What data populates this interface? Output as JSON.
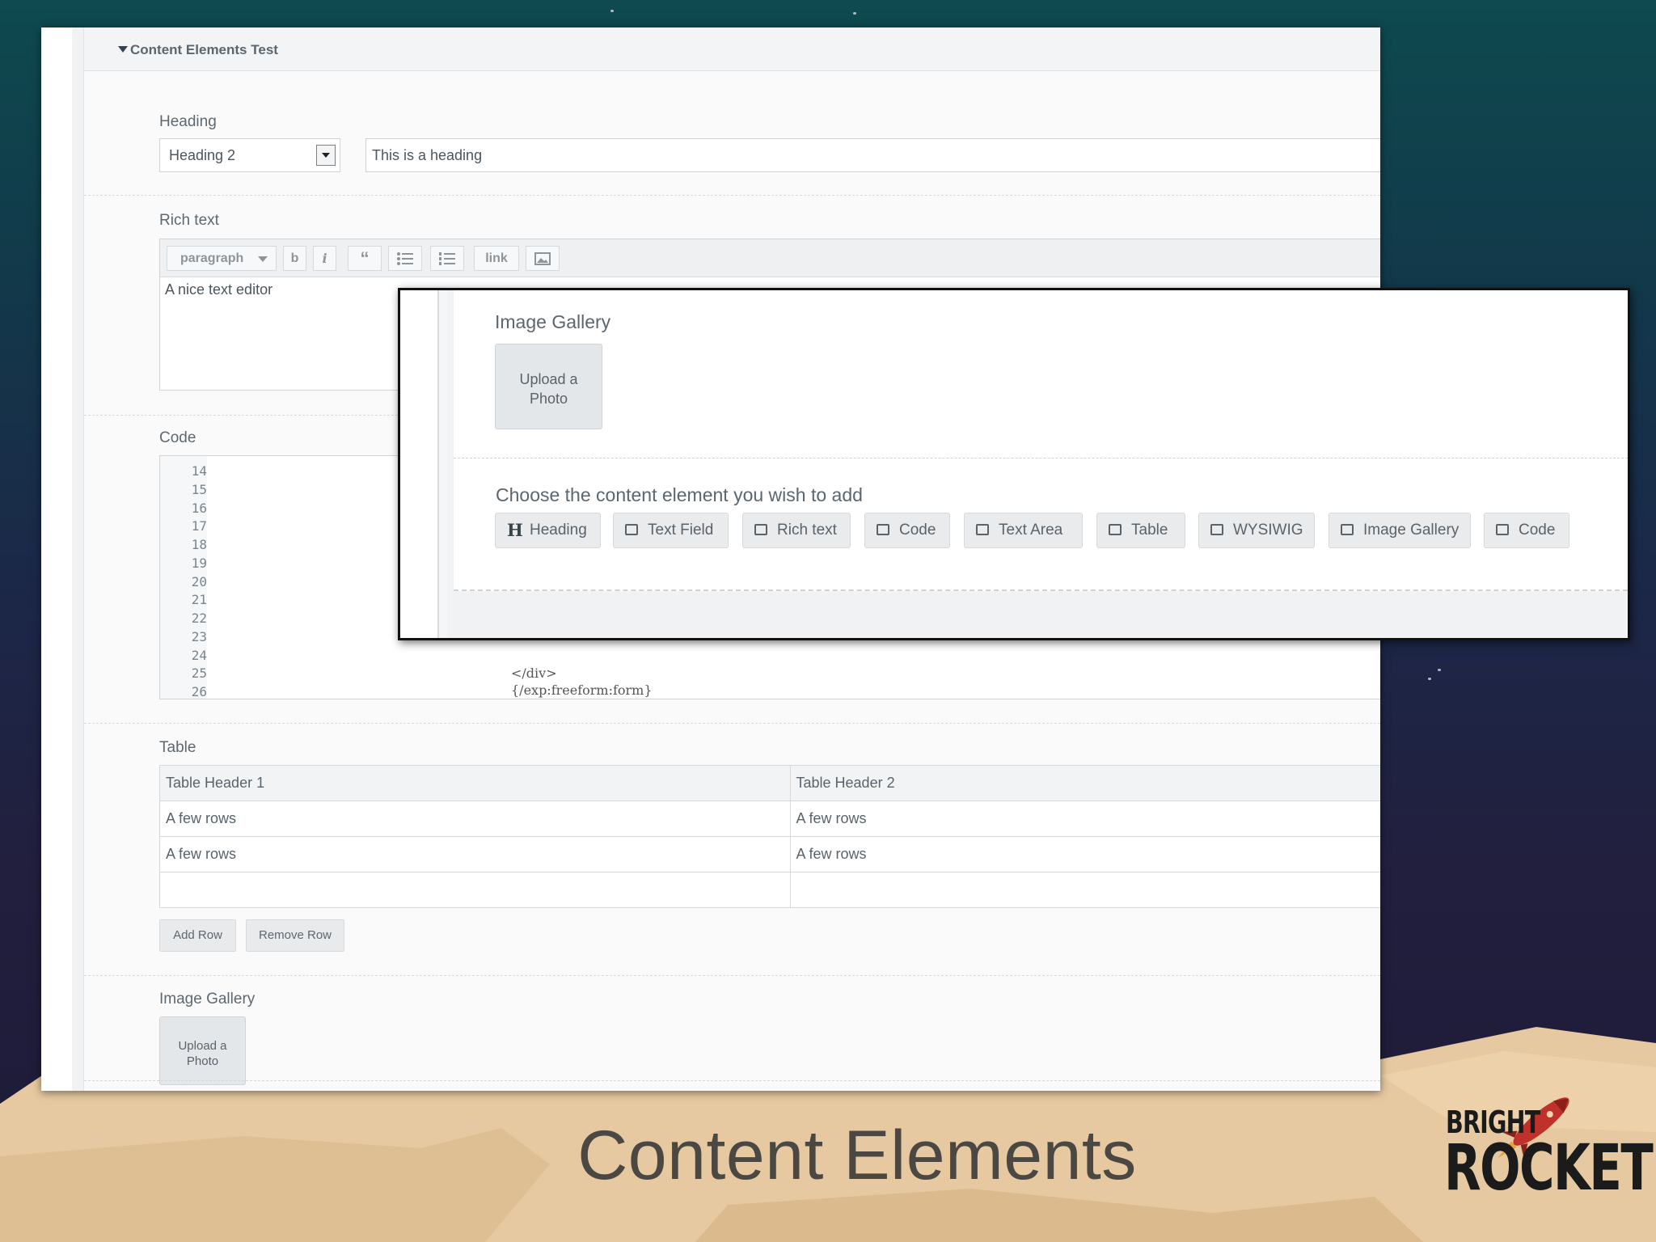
{
  "section": {
    "title": "Content Elements Test"
  },
  "heading_field": {
    "label": "Heading",
    "select_value": "Heading 2",
    "text_value": "This is a heading"
  },
  "rich_text": {
    "label": "Rich text",
    "toolbar": {
      "format": "paragraph",
      "bold": "b",
      "italic": "i",
      "quote": "“",
      "link": "link"
    },
    "content": "A nice text editor"
  },
  "code": {
    "label": "Code",
    "line_numbers": [
      "14",
      "15",
      "16",
      "17",
      "18",
      "19",
      "20",
      "21",
      "22",
      "23",
      "24",
      "25",
      "26"
    ],
    "visible_lines": [
      "</div>",
      "{/exp:freeform:form}"
    ]
  },
  "table": {
    "label": "Table",
    "headers": [
      "Table Header 1",
      "Table Header 2"
    ],
    "rows": [
      [
        "A few rows",
        "A few rows"
      ],
      [
        "A few rows",
        "A few rows"
      ],
      [
        "",
        ""
      ]
    ],
    "add_row": "Add Row",
    "remove_row": "Remove Row"
  },
  "gallery": {
    "label": "Image Gallery",
    "upload_line1": "Upload a",
    "upload_line2": "Photo"
  },
  "zoom": {
    "gallery_label": "Image Gallery",
    "upload_line1": "Upload a",
    "upload_line2": "Photo",
    "choose_label": "Choose the content element you wish to add",
    "buttons": [
      {
        "label": "Heading",
        "icon": "heading-icon"
      },
      {
        "label": "Text Field",
        "icon": "text-field-icon"
      },
      {
        "label": "Rich text",
        "icon": "rich-text-icon"
      },
      {
        "label": "Code",
        "icon": "code-icon"
      },
      {
        "label": "Text Area",
        "icon": "text-area-icon"
      },
      {
        "label": "Table",
        "icon": "table-icon"
      },
      {
        "label": "WYSIWIG",
        "icon": "wysiwyg-icon"
      },
      {
        "label": "Image Gallery",
        "icon": "image-gallery-icon"
      },
      {
        "label": "Code",
        "icon": "code-icon"
      }
    ]
  },
  "slide": {
    "title": "Content Elements",
    "logo_top": "BRIGHT",
    "logo_bottom": "ROCKET"
  },
  "colors": {
    "rocket_red": "#c0312b",
    "logo_dark": "#1b1b1b",
    "desert": "#e3c49a"
  }
}
